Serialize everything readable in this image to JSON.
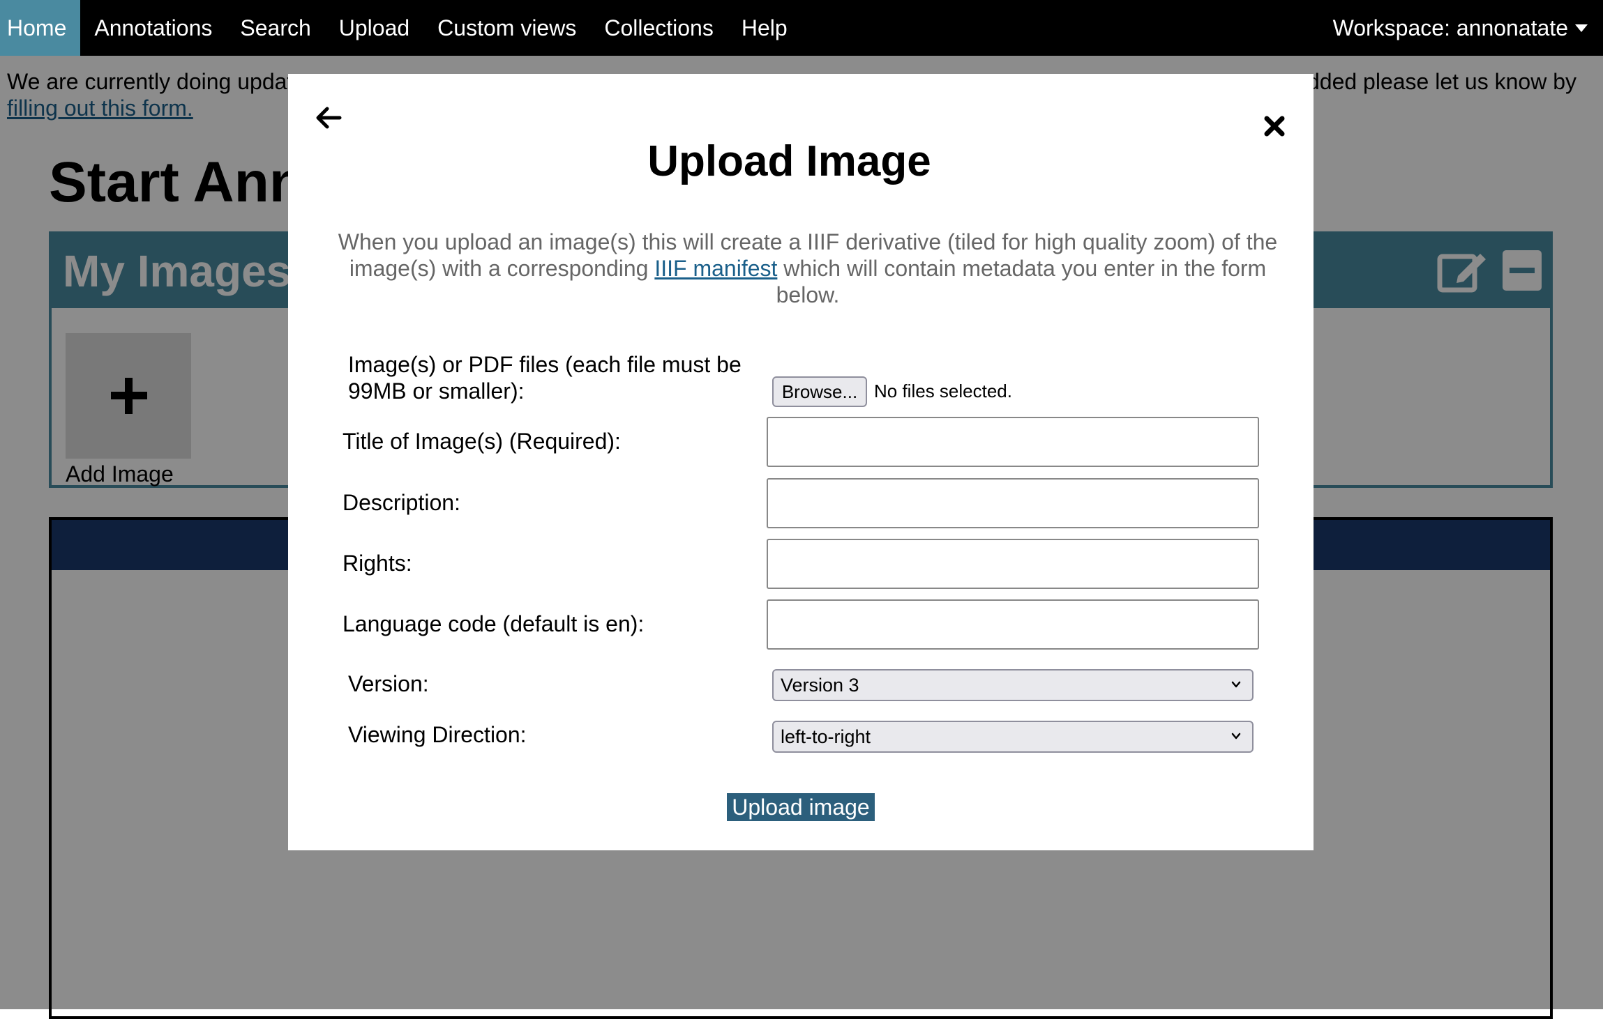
{
  "navbar": {
    "items": [
      {
        "label": "Home"
      },
      {
        "label": "Annotations"
      },
      {
        "label": "Search"
      },
      {
        "label": "Upload"
      },
      {
        "label": "Custom views"
      },
      {
        "label": "Collections"
      },
      {
        "label": "Help"
      }
    ],
    "active": "Home",
    "workspace_label": "Workspace: annonatate"
  },
  "banner": {
    "text_left": "We are currently doing updat",
    "text_right": "dded please let us know by",
    "link_text": "filling out this form."
  },
  "page": {
    "title": "Start Ann",
    "my_images_title": "My Images",
    "add_image_label": "Add Image"
  },
  "modal": {
    "title": "Upload Image",
    "description_part1": "When you upload an image(s) this will create a IIIF derivative (tiled for high quality zoom) of the image(s) with a corresponding ",
    "description_link": "IIIF manifest",
    "description_part2": " which will contain metadata you enter in the form below.",
    "file_label": "Image(s) or PDF files (each file must be 99MB or smaller):",
    "browse_label": "Browse...",
    "file_status": "No files selected.",
    "title_label": "Title of Image(s) (Required):",
    "title_value": "",
    "description_label": "Description:",
    "description_value": "",
    "rights_label": "Rights:",
    "rights_value": "",
    "language_label": "Language code (default is en):",
    "language_value": "",
    "version_label": "Version:",
    "version_value": "Version 3",
    "direction_label": "Viewing Direction:",
    "direction_value": "left-to-right",
    "submit_label": "Upload image"
  },
  "colors": {
    "nav_bg": "#000000",
    "nav_active": "#4a8aa0",
    "panel_teal": "#4a8aa0",
    "viewer_header": "#1a3a6e",
    "link": "#1a5f8a",
    "submit_bg": "#2c5f7c"
  },
  "icons": [
    "back-arrow-icon",
    "close-icon",
    "edit-icon",
    "minimize-icon",
    "plus-icon",
    "chevron-down-icon",
    "caret-down-icon"
  ]
}
